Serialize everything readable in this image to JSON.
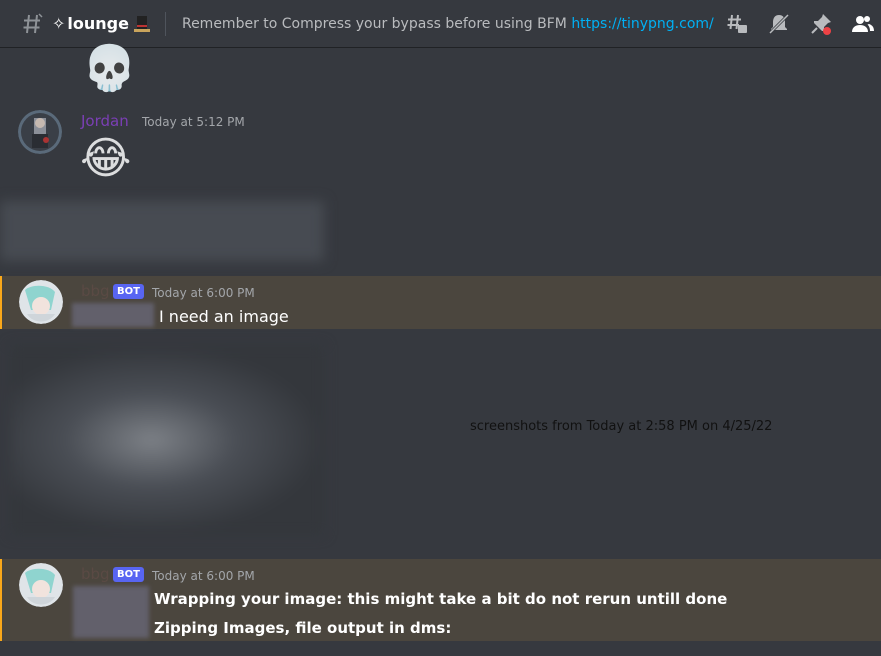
{
  "header": {
    "channel_prefix": "✧",
    "channel_name": "lounge",
    "topic_text": "Remember to Compress your bypass before using BFM ",
    "topic_link": "https://tinypng.com/"
  },
  "toolbar": {
    "icons": [
      "threads-icon",
      "mute-icon",
      "pins-icon",
      "members-icon"
    ]
  },
  "messages": {
    "skull_emoji": "💀",
    "jordan": {
      "username": "Jordan",
      "timestamp": "Today at 5:12 PM",
      "emoji": "😂",
      "username_color": "#7b3fb5"
    },
    "bbg1": {
      "username": "bbg",
      "tag": "BOT",
      "timestamp": "Today at 6:00 PM",
      "text": "I need an image"
    },
    "caption": "screenshots from Today at 2:58 PM on 4/25/22",
    "bbg2": {
      "username": "bbg",
      "tag": "BOT",
      "timestamp": "Today at 6:00 PM",
      "line1": "Wrapping your image: this might take a bit do not rerun untill done",
      "line2": "Zipping Images, file output in dms:"
    }
  },
  "colors": {
    "background": "#36393f",
    "highlight": "#4b463e",
    "highlight_bar": "#faa81a",
    "link": "#00b0f4",
    "bot_tag": "#5865f2"
  }
}
